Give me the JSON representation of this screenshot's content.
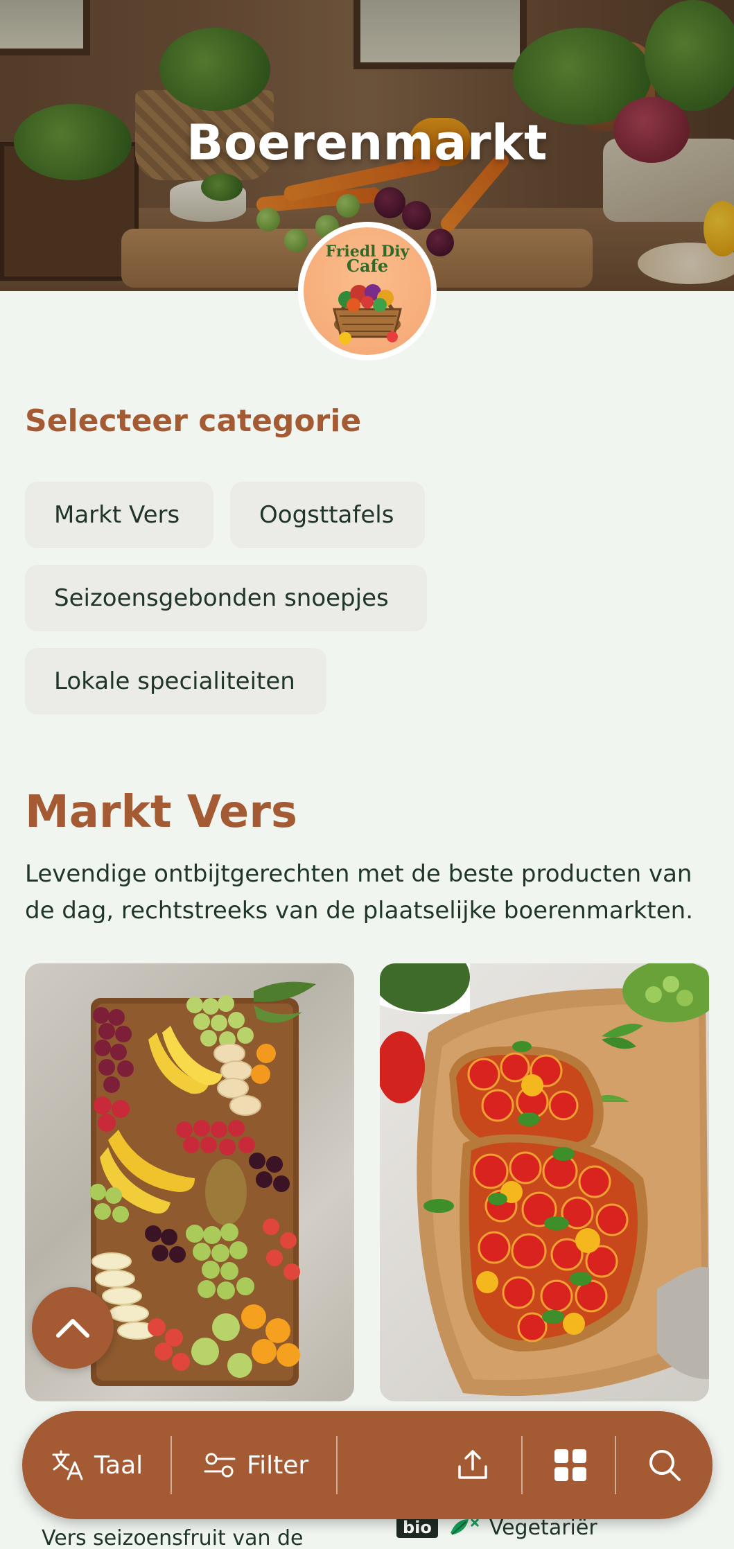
{
  "hero": {
    "title": "Boerenmarkt",
    "logo_alt": "Friedl Diy Cafe",
    "logo_text_line1": "Friedl Diy",
    "logo_text_line2": "Cafe"
  },
  "categories": {
    "heading": "Selecteer categorie",
    "items": [
      {
        "label": "Markt Vers"
      },
      {
        "label": "Oogsttafels"
      },
      {
        "label": "Seizoensgebonden snoepjes"
      },
      {
        "label": "Lokale specialiteiten"
      }
    ]
  },
  "section": {
    "title": "Markt Vers",
    "description": "Levendige ontbijtgerechten met de beste producten van de dag, rechtstreeks van de plaatselijke boerenmarkten."
  },
  "cards": [
    {
      "image": "fruit-platter",
      "text": "Vers seizoensfruit van de"
    },
    {
      "image": "tomato-toast",
      "badges": [
        "bio"
      ],
      "diet": "Vegetariër"
    }
  ],
  "bottom_bar": {
    "language_label": "Taal",
    "filter_label": "Filter",
    "icons": [
      "translate-icon",
      "filter-icon",
      "share-icon",
      "grid-icon",
      "search-icon"
    ]
  },
  "colors": {
    "accent": "#a45a33",
    "background": "#f1f5f0",
    "chip_bg": "#ebece7",
    "text": "#1f3526"
  }
}
